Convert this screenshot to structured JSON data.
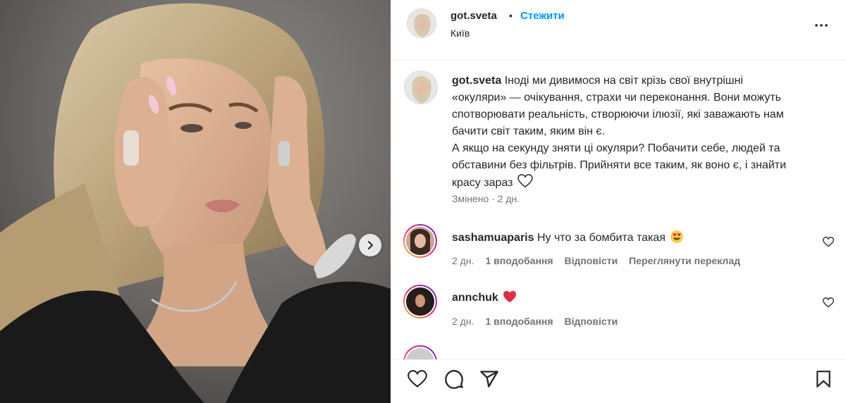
{
  "post": {
    "username": "got.sveta",
    "follow_label": "Стежити",
    "separator": "•",
    "location": "Київ"
  },
  "caption": {
    "username": "got.sveta",
    "text": "Іноді ми дивимося на світ крізь свої внутрішні «окуляри» — очікування, страхи чи переконання. Вони можуть спотворювати реальність, створюючи ілюзії, які заважають нам бачити світ таким, яким він є.",
    "text2": "А якщо на секунду зняти ці окуляри? Побачити себе, людей та обставини без фільтрів. Прийняти все таким, як воно є, і знайти красу зараз",
    "meta": "Змінено · 2 дн."
  },
  "comments": [
    {
      "username": "sashamuaparis",
      "text": "Ну что за бомбита такая",
      "emoji": "heart-eyes",
      "time": "2 дн.",
      "likes": "1 вподобання",
      "reply": "Відповісти",
      "translate": "Переглянути переклад"
    },
    {
      "username": "annchuk",
      "text": "",
      "emoji": "red-heart",
      "time": "2 дн.",
      "likes": "1 вподобання",
      "reply": "Відповісти"
    }
  ],
  "colors": {
    "follow": "#0095f6",
    "muted": "#737373",
    "text": "#262626",
    "heart_red": "#ed4956"
  },
  "icons": {
    "more": "more-horizontal-icon",
    "like": "heart-outline-icon",
    "comment": "comment-icon",
    "share": "share-icon",
    "save": "bookmark-icon",
    "next": "chevron-right-icon"
  }
}
